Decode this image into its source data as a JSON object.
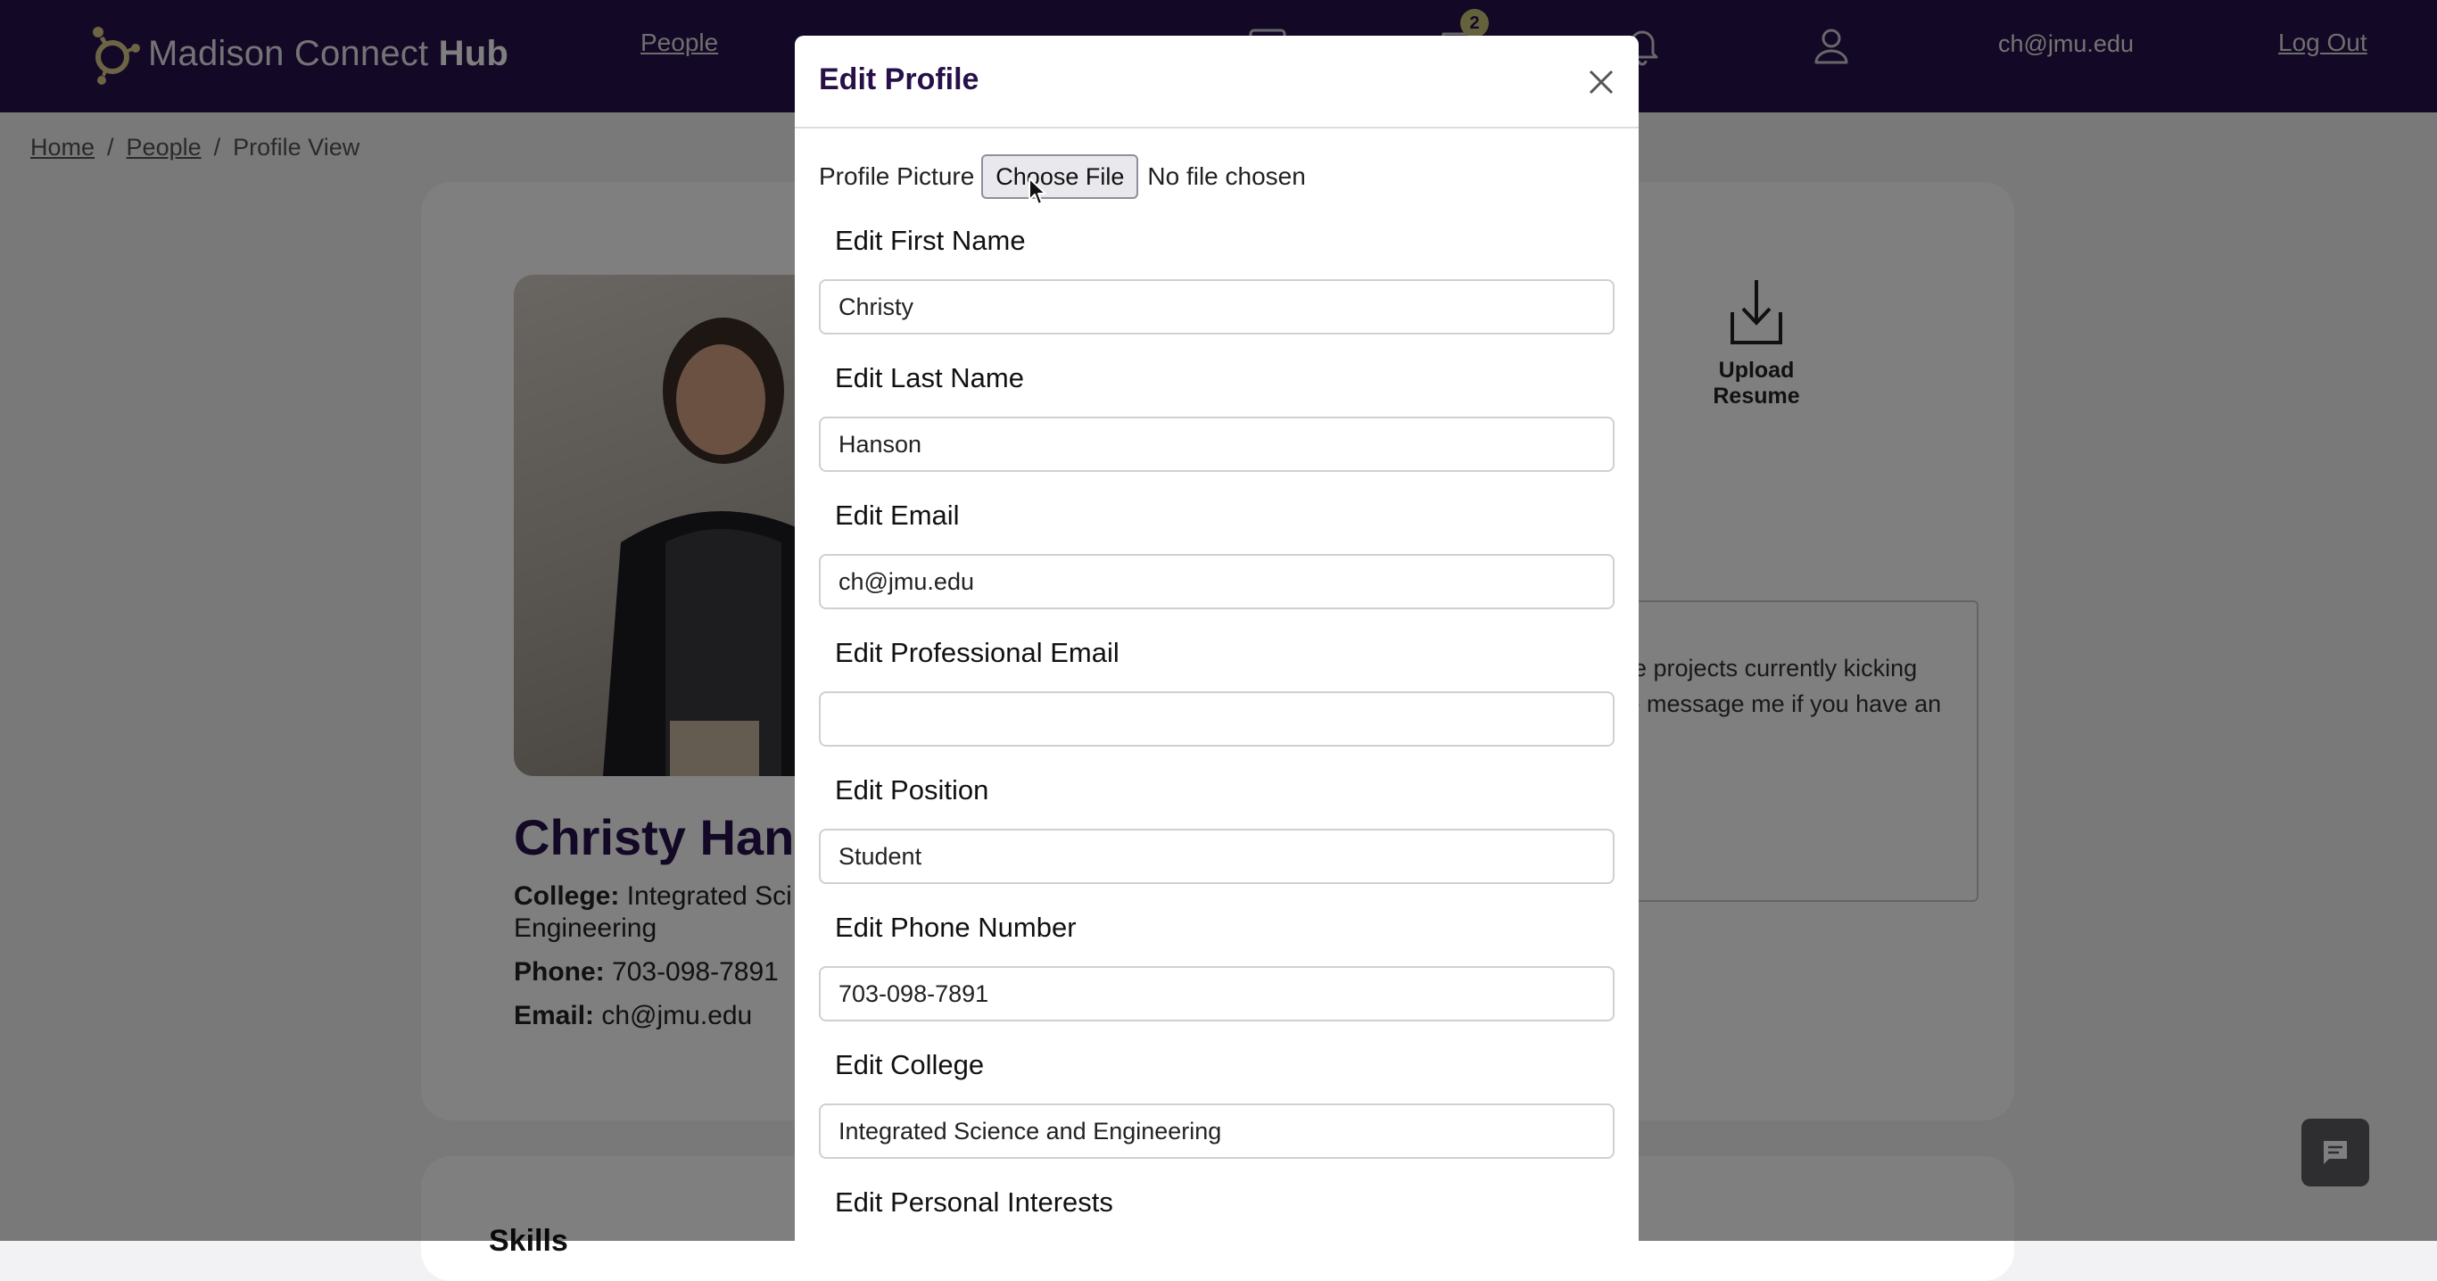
{
  "navbar": {
    "brand_regular": "Madison Connect ",
    "brand_bold": "Hub",
    "people_link": "People",
    "notification_count": "2",
    "user_email": "ch@jmu.edu",
    "logout_link": "Log Out"
  },
  "breadcrumb": {
    "items": [
      "Home",
      "People",
      "Profile View"
    ],
    "separator": "/"
  },
  "profile": {
    "name": "Christy Hans",
    "college_label": "College:",
    "college_value": "Integrated Sci",
    "college_value_line2": "Engineering",
    "phone_label": "Phone:",
    "phone_value": "703-098-7891",
    "email_label": "Email:",
    "email_value": "ch@jmu.edu",
    "upload_resume_label": "Upload Resume",
    "about_text": "ne projects currently kicking\n e message me if you have an",
    "skills_heading": "Skills"
  },
  "modal": {
    "title": "Edit Profile",
    "profile_picture_label": "Profile Picture",
    "choose_file_label": "Choose File",
    "no_file_text": "No file chosen",
    "fields": [
      {
        "label": "Edit First Name",
        "value": "Christy"
      },
      {
        "label": "Edit Last Name",
        "value": "Hanson"
      },
      {
        "label": "Edit Email",
        "value": "ch@jmu.edu"
      },
      {
        "label": "Edit Professional Email",
        "value": ""
      },
      {
        "label": "Edit Position",
        "value": "Student"
      },
      {
        "label": "Edit Phone Number",
        "value": "703-098-7891"
      },
      {
        "label": "Edit College",
        "value": "Integrated Science and Engineering"
      },
      {
        "label": "Edit Personal Interests",
        "value": ""
      }
    ]
  },
  "colors": {
    "navbar_bg": "#27104a",
    "accent_purple": "#27104a",
    "badge_bg": "#c8c37a",
    "overlay": "rgba(0,0,0,0.5)"
  },
  "icons": [
    "logo-icon",
    "calendar-icon",
    "messages-icon",
    "bell-icon",
    "user-icon",
    "download-icon",
    "close-icon",
    "chat-icon",
    "cursor-icon"
  ]
}
